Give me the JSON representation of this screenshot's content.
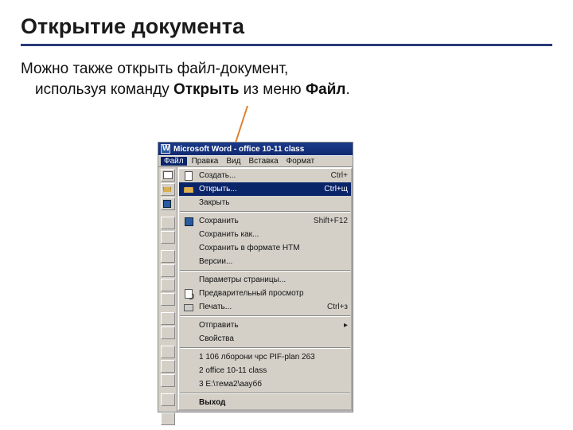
{
  "title": "Открытие документа",
  "body": {
    "line1": "Можно также открыть файл-документ,",
    "line2_pre": "используя команду ",
    "line2_bold1": "Открыть",
    "line2_mid": " из меню ",
    "line2_bold2": "Файл",
    "line2_end": "."
  },
  "word": {
    "titlebar": "Microsoft Word - office 10-11 class",
    "menubar": [
      "Файл",
      "Правка",
      "Вид",
      "Вставка",
      "Формат"
    ],
    "menu": {
      "items": [
        {
          "icon": "inew",
          "label": "Создать...",
          "short": "Ctrl+"
        },
        {
          "icon": "iopen",
          "label": "Открыть...",
          "short": "Ctrl+щ"
        },
        {
          "icon": "iblank",
          "label": "Закрыть",
          "short": ""
        }
      ],
      "items2": [
        {
          "icon": "isave",
          "label": "Сохранить",
          "short": "Shift+F12"
        },
        {
          "icon": "iblank",
          "label": "Сохранить как...",
          "short": ""
        },
        {
          "icon": "iblank",
          "label": "Сохранить в формате HTM",
          "short": ""
        },
        {
          "icon": "iblank",
          "label": "Версии...",
          "short": ""
        }
      ],
      "items3": [
        {
          "icon": "iblank",
          "label": "Параметры страницы...",
          "short": ""
        },
        {
          "icon": "ipreview",
          "label": "Предварительный просмотр",
          "short": ""
        },
        {
          "icon": "iprint",
          "label": "Печать...",
          "short": "Ctrl+з"
        }
      ],
      "items4": [
        {
          "icon": "iblank",
          "label": "Отправить",
          "short": "▸"
        },
        {
          "icon": "iblank",
          "label": "Свойства",
          "short": ""
        }
      ],
      "recent": [
        "1 106 лборони чрс PIF-plan 263",
        "2 office 10-11 class",
        "3 E:\\тема2\\ааубб"
      ],
      "exit": "Выход"
    }
  }
}
